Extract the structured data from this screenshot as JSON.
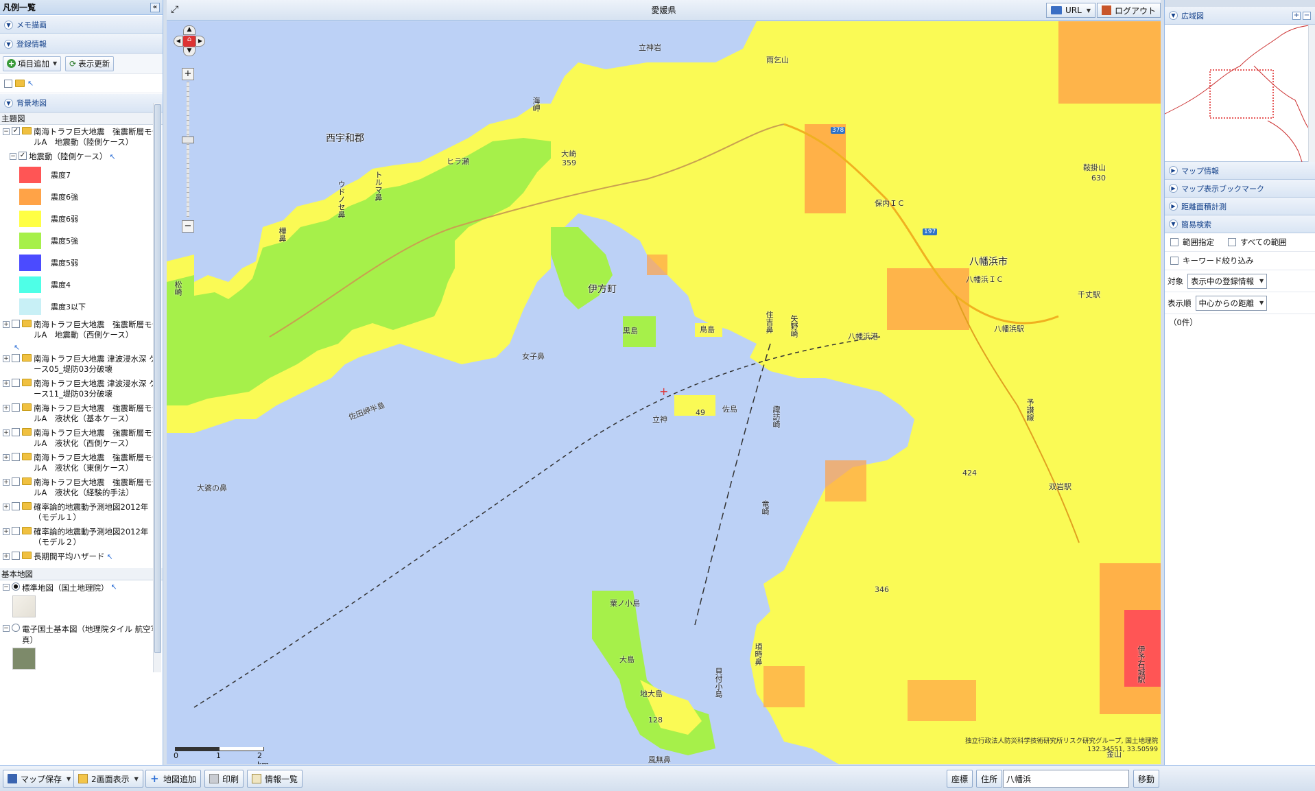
{
  "left_panel": {
    "title": "凡例一覧",
    "sections": {
      "memo": "メモ描画",
      "registered": "登録情報",
      "background": "背景地図"
    },
    "add_item_label": "項目追加",
    "refresh_label": "表示更新",
    "theme_heading": "主題図",
    "base_heading": "基本地図",
    "layers": [
      {
        "label": "南海トラフ巨大地震　強震断層モデルA　地震動（陸側ケース）",
        "checked": true
      },
      {
        "label": "南海トラフ巨大地震　強震断層モデルA　地震動（西側ケース）",
        "checked": false
      },
      {
        "label": "南海トラフ巨大地震 津波浸水深 ケース05_堤防03分破壊",
        "checked": false
      },
      {
        "label": "南海トラフ巨大地震 津波浸水深 ケース11_堤防03分破壊",
        "checked": false
      },
      {
        "label": "南海トラフ巨大地震　強震断層モデルA　液状化（基本ケース）",
        "checked": false
      },
      {
        "label": "南海トラフ巨大地震　強震断層モデルA　液状化（西側ケース）",
        "checked": false
      },
      {
        "label": "南海トラフ巨大地震　強震断層モデルA　液状化（東側ケース）",
        "checked": false
      },
      {
        "label": "南海トラフ巨大地震　強震断層モデルA　液状化（経験的手法）",
        "checked": false
      },
      {
        "label": "確率論的地震動予測地図2012年（モデル１）",
        "checked": false
      },
      {
        "label": "確率論的地震動予測地図2012年（モデル２）",
        "checked": false
      },
      {
        "label": "長期間平均ハザード",
        "checked": false
      }
    ],
    "sublayer": "地震動（陸側ケース）",
    "legend": [
      {
        "label": "震度7",
        "color": "#ff5555"
      },
      {
        "label": "震度6強",
        "color": "#ffa347"
      },
      {
        "label": "震度6弱",
        "color": "#ffff44"
      },
      {
        "label": "震度5強",
        "color": "#a6f04a"
      },
      {
        "label": "震度5弱",
        "color": "#4b4bff"
      },
      {
        "label": "震度4",
        "color": "#4effe7"
      },
      {
        "label": "震度3以下",
        "color": "#c8f0f6"
      }
    ],
    "base_maps": [
      {
        "label": "標準地図（国土地理院）",
        "selected": true
      },
      {
        "label": "電子国土基本図（地理院タイル 航空写真）",
        "selected": false
      }
    ]
  },
  "map": {
    "title": "愛媛県",
    "url_label": "URL",
    "logout_label": "ログアウト",
    "attribution": "独立行政法人防災科学技術研究所リスク研究グループ, 国土地理院",
    "coords": "132.34551, 33.50599",
    "scale_labels": [
      "0",
      "1",
      "2 km"
    ],
    "places": {
      "nishiuwa": "西宇和郡",
      "ikata": "伊方町",
      "yawatahama": "八幡浜市",
      "yawatahama_ic": "八幡浜ＩＣ",
      "yawatahama_st": "八幡浜駅",
      "yawatahama_port": "八幡浜港",
      "senjo_st": "千丈駅",
      "futaiwa_st": "双岩駅",
      "honai_ic": "保内ＩＣ",
      "ujinokuchi": "大崎",
      "kuroshima": "黒島",
      "torishima": "鳥島",
      "sadamisaki": "佐田岬半島",
      "tategami": "立神",
      "sashima": "佐島",
      "onago": "女子鼻",
      "oshima": "大島",
      "jidaijima": "地大島",
      "awanokoshima": "粟ノ小島",
      "kazenashi": "風無鼻",
      "higanosaki": "大碆の鼻",
      "amagoyama": "雨乞山",
      "tategamiiwa": "立神岩",
      "higurashi": "ヒラ瀬",
      "kurakakeyama": "鞍掛山",
      "kinshoyama": "金山",
      "iyo_ishigaki": "伊予石城駅",
      "h359": "359",
      "h630": "630",
      "h424": "424",
      "h346": "346",
      "h49": "49",
      "h128": "128",
      "route378": "378",
      "route197": "197"
    },
    "vertical_labels": {
      "kaimisaki": "海岬",
      "torumahana": "トルマ鼻",
      "udonose": "ウドノセ鼻",
      "kabutohana": "樺鼻",
      "matsusaki": "松崎",
      "yanozaki": "矢野崎",
      "sumiyoshi": "住吉鼻",
      "suwazaki": "諏訪崎",
      "tatsusaki": "竜崎",
      "kasumi": "頃時鼻",
      "kaikoshima": "貝付小島",
      "yosan": "予讃線"
    }
  },
  "right_panel": {
    "overview_title": "広域図",
    "map_info": "マップ情報",
    "bookmark": "マップ表示ブックマーク",
    "measure": "距離面積計測",
    "simple_search": "簡易検索",
    "range_label": "範囲指定",
    "all_range_label": "すべての範囲",
    "keyword_label": "キーワード絞り込み",
    "target_label": "対象",
    "target_value": "表示中の登録情報",
    "order_label": "表示順",
    "order_value": "中心からの距離",
    "count": "（0件）"
  },
  "bottom": {
    "save_map": "マップ保存",
    "two_screen": "2画面表示",
    "add_map": "地図追加",
    "print": "印刷",
    "info_list": "情報一覧",
    "coord_btn": "座標",
    "address_btn": "住所",
    "address_value": "八幡浜",
    "move_btn": "移動"
  }
}
